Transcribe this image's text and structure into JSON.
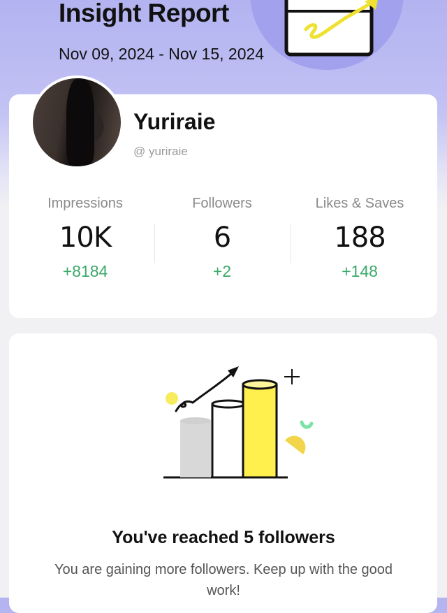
{
  "header": {
    "title": "Insight Report",
    "date_range": "Nov 09, 2024 - Nov 15, 2024"
  },
  "profile": {
    "name": "Yuriraie",
    "handle": "@ yuriraie",
    "avatar_icon": "profile-photo"
  },
  "stats": [
    {
      "label": "Impressions",
      "value": "10K",
      "change": "+8184"
    },
    {
      "label": "Followers",
      "value": "6",
      "change": "+2"
    },
    {
      "label": "Likes & Saves",
      "value": "188",
      "change": "+148"
    }
  ],
  "milestone": {
    "title": "You've reached 5 followers",
    "description": "You are gaining more followers. Keep up with the good work!",
    "illustration_icon": "growth-bar-chart-illustration"
  },
  "colors": {
    "header_background": "#b3b3f1",
    "accent_circle": "#a1a1ee",
    "positive_change": "#3aa96a",
    "highlight_yellow": "#fff04d"
  }
}
